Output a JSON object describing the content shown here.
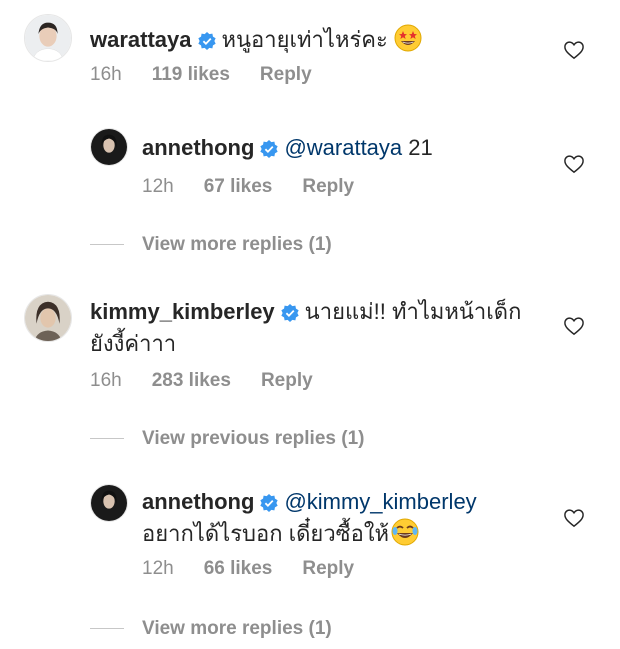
{
  "colors": {
    "verified": "#3897f0",
    "mention": "#00376b",
    "meta": "#8e8e8e",
    "text": "#262626"
  },
  "comments": [
    {
      "username": "warattaya",
      "text": "หนูอายุเท่าไหร่คะ",
      "emoji": "star-struck-emoji",
      "time": "16h",
      "likes": "119 likes",
      "reply": "Reply"
    },
    {
      "username": "annethong",
      "mention": "@warattaya",
      "text": "21",
      "time": "12h",
      "likes": "67 likes",
      "reply": "Reply"
    },
    {
      "username": "kimmy_kimberley",
      "text_line1": "นายแม่!! ทำไมหน้าเด็ก",
      "text_line2": "ยังงี้ค่าาา",
      "time": "16h",
      "likes": "283 likes",
      "reply": "Reply"
    },
    {
      "username": "annethong",
      "mention": "@kimmy_kimberley",
      "text_line2": "อยากได้ไรบอก เดี๋ยวซื้อให้",
      "emoji": "laughing-emoji",
      "time": "12h",
      "likes": "66 likes",
      "reply": "Reply"
    }
  ],
  "view_more_1": "View more replies (1)",
  "view_previous": "View previous replies (1)",
  "view_more_2": "View more replies (1)"
}
